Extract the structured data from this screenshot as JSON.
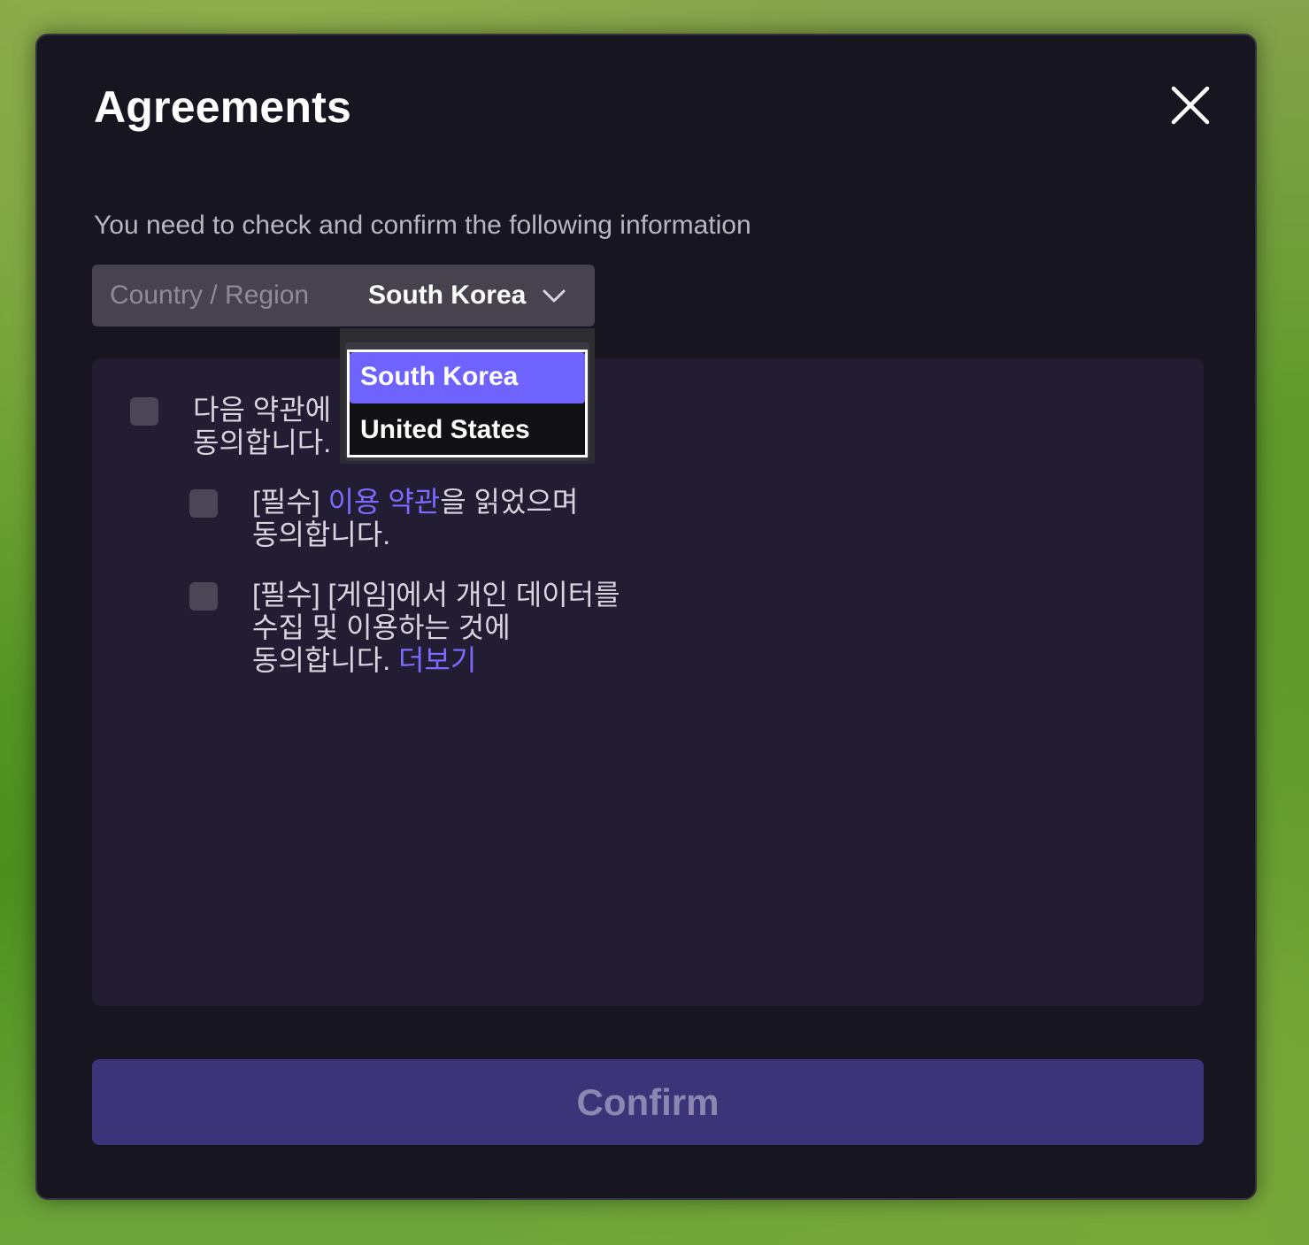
{
  "modal": {
    "title": "Agreements",
    "subtitle": "You need to check and confirm the following information"
  },
  "region": {
    "label": "Country / Region",
    "value": "South Korea",
    "options": [
      "South Korea",
      "United States"
    ],
    "selected_index": 0
  },
  "agreements": {
    "all": {
      "line1": "다음 약관에",
      "line2": "동의합니다."
    },
    "terms": {
      "prefix": "[필수] ",
      "link": "이용 약관",
      "suffix": "을 읽었으며",
      "line2": "동의합니다."
    },
    "privacy": {
      "line1": "[필수] [게임]에서 개인 데이터를",
      "line2": "수집 및 이용하는 것에",
      "line3_prefix": "동의합니다. ",
      "more_link": "더보기"
    }
  },
  "confirm_label": "Confirm",
  "colors": {
    "modal_bg": "#17151f",
    "panel_bg": "#221d33",
    "accent": "#6f63ff",
    "link": "#7b6cff",
    "confirm_bg": "#3b3478"
  },
  "icons": {
    "close": "close-icon",
    "chevron": "chevron-down-icon"
  }
}
